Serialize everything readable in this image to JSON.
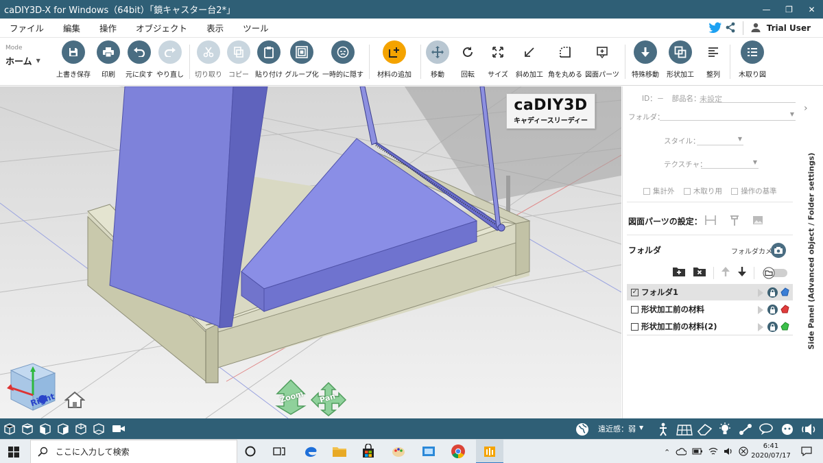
{
  "window": {
    "title": "caDIY3D-X for Windows（64bit）「鏡キャスター台2*」"
  },
  "menu": {
    "items": [
      "ファイル",
      "編集",
      "操作",
      "オブジェクト",
      "表示",
      "ツール"
    ],
    "user": "Trial User"
  },
  "toolbar": {
    "mode_label": "Mode",
    "mode_value": "ホーム",
    "tools": [
      {
        "label": "上書き保存"
      },
      {
        "label": "印刷"
      },
      {
        "label": "元に戻す"
      },
      {
        "label": "やり直し"
      },
      {
        "label": "切り取り"
      },
      {
        "label": "コピー"
      },
      {
        "label": "貼り付け"
      },
      {
        "label": "グループ化"
      },
      {
        "label": "一時的に隠す"
      },
      {
        "label": "材料の追加"
      },
      {
        "label": "移動"
      },
      {
        "label": "回転"
      },
      {
        "label": "サイズ"
      },
      {
        "label": "斜め加工"
      },
      {
        "label": "角を丸める"
      },
      {
        "label": "図面パーツ"
      },
      {
        "label": "特殊移動"
      },
      {
        "label": "形状加工"
      },
      {
        "label": "整列"
      },
      {
        "label": "木取り図"
      }
    ]
  },
  "viewport": {
    "logo_main": "caDIY3D",
    "logo_sub": "キャディースリーディー",
    "cube_label": "Right",
    "zoom_label": "Zoom",
    "pan_label": "Pan"
  },
  "side_panel": {
    "id_label": "ID：",
    "id_value": "－",
    "part_name_label": "部品名：",
    "part_name_placeholder": "未設定",
    "folder_label": "フォルダ：",
    "style_label": "スタイル：",
    "texture_label": "テクスチャ：",
    "check_exclude": "集計外",
    "check_kidori": "木取り用",
    "check_base": "操作の基準",
    "drawing_parts_heading": "図面パーツの設定：",
    "folder_heading": "フォルダ",
    "folder_camera_label": "フォルダカメラ",
    "vertical_label": "Side Panel (Advanced object / Folder settings)",
    "folders": [
      {
        "name": "フォルダ1",
        "checked": true
      },
      {
        "name": "形状加工前の材料",
        "checked": false
      },
      {
        "name": "形状加工前の材料(2)",
        "checked": false
      }
    ]
  },
  "view_bar": {
    "perspective_label": "遠近感：弱"
  },
  "taskbar": {
    "search_placeholder": "ここに入力して検索",
    "time": "6:41",
    "date": "2020/07/17"
  },
  "colors": {
    "titlebar": "#2f5f76",
    "accent_orange": "#f4a300",
    "tool_dark": "#4a6d82",
    "object_purple": "#7b7fd6",
    "frame_wood": "#c9c9ac"
  }
}
